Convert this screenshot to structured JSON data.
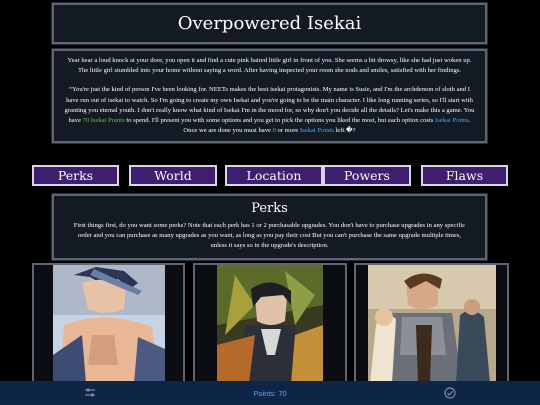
{
  "title": "Overpowered Isekai",
  "intro": {
    "p1": "Year hear a loud knock at your door, you open it and find a cute pink haired little girl in front of you. She seems a bit drowsy, like she had just woken up. The little girl stumbled into your home without saying a word. After having inspected your room she nods and smiles, satisfied with her findings.",
    "p2_a": "“You're just the kind of person I've been looking for. NEETs makes the best isekai protagonists. My name is Susie, and I'm the archdemon of sloth and I have run out of isekai to watch. So I'm going to create my own Isekai and you're going to be the main character. I like long running series, so I'll start with granting you eternal youth. I don't really know what kind of Isekai I'm in the mood for, so why don't you decide all the details? Let's make this a game. You have ",
    "p2_points": "70 Isekai Points",
    "p2_b": " to spend. I'll present you with some options and you get to pick the options you liked the most, but each option costs ",
    "p2_points2": "Isekai Points",
    "p2_c": ".",
    "p3_a": "Once we are done you must have ",
    "p3_zero": "0",
    "p3_b": " or more ",
    "p3_points": "Isekai Points",
    "p3_c": " left.�?"
  },
  "nav": [
    {
      "label": "Perks"
    },
    {
      "label": "World"
    },
    {
      "label": "Location"
    },
    {
      "label": "Powers"
    },
    {
      "label": "Flaws"
    }
  ],
  "section": {
    "heading": "Perks",
    "description": "First things first, do you want some perks? Note that each perk has 1 or 2 purchasable upgrades. You don't have to purchase upgrades in any specific order and you can purchase as many upgrades as you want, as long as you pay their cost But you can't purchase the same upgrade multiple times, unless it says so in the upgrade's description."
  },
  "footer": {
    "points_text": "Points: 70"
  },
  "colors": {
    "nav_bg": "#3e1e6e",
    "footer_bg": "#0f2548",
    "points_green": "#5ec24a",
    "points_blue": "#4aa9ff"
  },
  "icons": [
    "settings-sliders-icon",
    "check-circle-icon"
  ]
}
